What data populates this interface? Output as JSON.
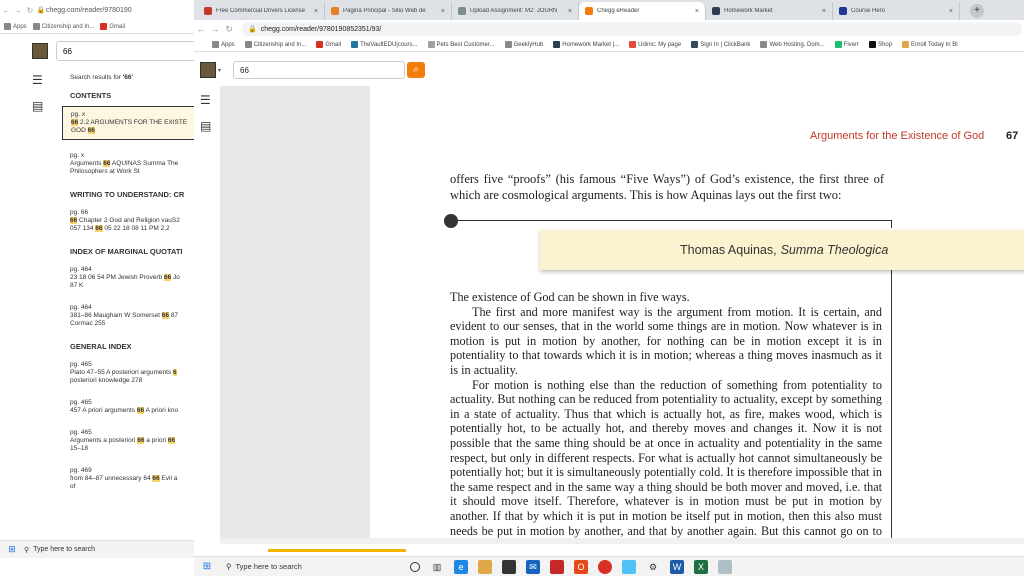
{
  "back_window": {
    "url": "chegg.com/reader/9780190",
    "bookmarks": [
      "Apps",
      "Citizenship and In...",
      "Gmail"
    ],
    "search_value": "66",
    "results_header_prefix": "Search results for ",
    "results_query": "'66'",
    "sections": [
      {
        "title": "CONTENTS",
        "items": [
          {
            "page": "pg. x",
            "pre": "",
            "hl": "66",
            "post": " 2.2 ARGUMENTS FOR THE EXISTE",
            "line2_pre": "GOD ",
            "line2_hl": "66",
            "selected": true
          },
          {
            "page": "pg. x",
            "pre": "Arguments ",
            "hl": "66",
            "post": " AQUINAS Summa The",
            "line2_pre": "Philosophers at Work St",
            "line2_hl": "",
            "selected": false
          }
        ]
      },
      {
        "title": "WRITING TO UNDERSTAND: CR",
        "items": [
          {
            "page": "pg. 66",
            "pre": "",
            "hl": "66",
            "post": " Chapter 2 God and Religion vauS2",
            "line2_pre": "057 134 ",
            "line2_hl": "66",
            "line2_post": " 05 22 18 08 11 PM 2.2",
            "selected": false
          }
        ]
      },
      {
        "title": "INDEX OF MARGINAL QUOTATI",
        "items": [
          {
            "page": "pg. 464",
            "pre": "23 18 06 54 PM Jewish Proverb ",
            "hl": "66",
            "post": " Jo",
            "line2_pre": "87 K",
            "line2_hl": "",
            "selected": false
          },
          {
            "page": "pg. 464",
            "pre": "381–86 Maugham W Somerset ",
            "hl": "66",
            "post": " 87",
            "line2_pre": "Cormac 255",
            "line2_hl": "",
            "selected": false
          }
        ]
      },
      {
        "title": "GENERAL INDEX",
        "items": [
          {
            "page": "pg. 465",
            "pre": "Plato 47–55 A posteriori arguments ",
            "hl": "6",
            "post": "",
            "line2_pre": "posteriori knowledge 278",
            "line2_hl": "",
            "selected": false
          },
          {
            "page": "pg. 465",
            "pre": "457 A priori arguments ",
            "hl": "66",
            "post": " A priori kno",
            "line2_pre": "",
            "line2_hl": "",
            "selected": false
          },
          {
            "page": "pg. 465",
            "pre": "Arguments a posteriori ",
            "hl": "66",
            "post": " a priori ",
            "post_hl": "66",
            "line2_pre": "15–18",
            "line2_hl": "",
            "selected": false
          },
          {
            "page": "pg. 469",
            "pre": "from 84–87 unnecessary 64 ",
            "hl": "66",
            "post": " Evil a",
            "line2_pre": "of",
            "line2_hl": "",
            "selected": false
          }
        ]
      }
    ],
    "taskbar_search": "Type here to search"
  },
  "front_window": {
    "tabs": [
      {
        "label": "Free Commercial Drivers License",
        "color": "#c0392b",
        "active": false
      },
      {
        "label": "Página Principal - Sitio Web de",
        "color": "#e67e22",
        "active": false
      },
      {
        "label": "Upload Assignment: M2: JOURN",
        "color": "#7f8c8d",
        "active": false
      },
      {
        "label": "Chegg eReader",
        "color": "#f47d0a",
        "active": true
      },
      {
        "label": "Homework Market",
        "color": "#2c3e50",
        "active": false
      },
      {
        "label": "Course Hero",
        "color": "#1e3799",
        "active": false
      }
    ],
    "url": "chegg.com/reader/9780190852351/93/",
    "bookmarks": [
      "Apps",
      "Citizenship and In...",
      "Gmail",
      "TheVaultEDU|cours...",
      "Pets Best Customer...",
      "GeeklyHub",
      "Homework Market |...",
      "Udinic: My page",
      "Sign In | ClickBank",
      "Web Hosting, Dom...",
      "Fiverr",
      "Shop",
      "Enroll Today In Bl"
    ],
    "search_value": "66",
    "taskbar_search": "Type here to search"
  },
  "book": {
    "running_head": "Arguments for the Existence of God",
    "page_number": "67",
    "intro": "offers five “proofs” (his famous “Five Ways”) of God’s existence, the first three of which are cosmological arguments. This is how Aquinas lays out the first two:",
    "source_author": "Thomas Aquinas,",
    "source_title": "Summa Theologica",
    "paragraphs": [
      "The existence of God can be shown in five ways.",
      "The first and more manifest way is the argument from motion. It is certain, and evident to our senses, that in the world some things are in motion. Now whatever is in motion is put in motion by another, for nothing can be in motion except it is in potentiality to that towards which it is in motion; whereas a thing moves inasmuch as it is in actuality.",
      "For motion is nothing else than the reduction of something from potentiality to actuality. But nothing can be reduced from potentiality to actuality, except by something in a state of actuality. Thus that which is actually hot, as fire, makes wood, which is potentially hot, to be actually hot, and thereby moves and changes it. Now it is not possible that the same thing should be at once in actuality and potentiality in the same respect, but only in different respects. For what is actually hot cannot simultaneously be potentially hot; but it is simultaneously potentially cold. It is therefore impossible that in the same respect and in the same way a thing should be both mover and moved, i.e. that it should move itself. Therefore, whatever is in motion must be put in motion by another. If that by which it is put in motion be itself put in motion, then this also must needs be put in motion by another, and that by another again. But this cannot go on to infinity, because then there"
    ]
  },
  "icons": {
    "back": "←",
    "forward": "→",
    "reload": "↻",
    "lock": "🔒",
    "search": "⌕",
    "toc": "☰",
    "notes": "▤",
    "windows": "⊞",
    "magnifier": "⚲",
    "close": "×",
    "plus": "+"
  }
}
